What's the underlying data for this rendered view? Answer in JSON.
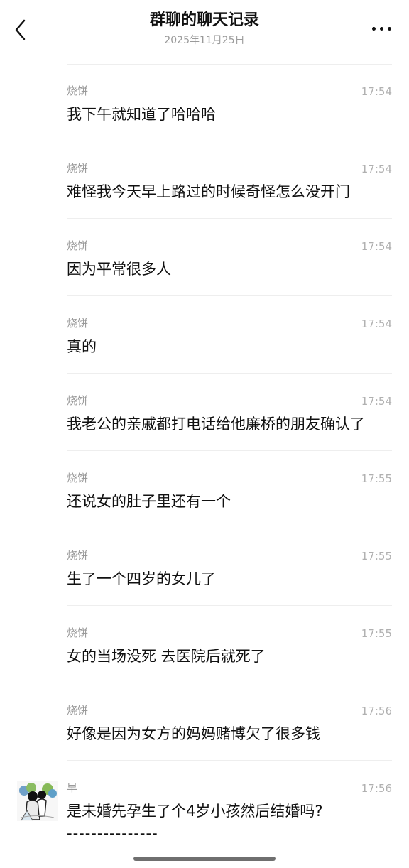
{
  "header": {
    "title": "群聊的聊天记录",
    "date": "2025年11月25日"
  },
  "icons": {
    "back": "chevron-left-icon",
    "more": "more-horizontal-icon"
  },
  "messages": [
    {
      "sender": "烧饼",
      "time": "17:54",
      "text": "我下午就知道了哈哈哈"
    },
    {
      "sender": "烧饼",
      "time": "17:54",
      "text": "难怪我今天早上路过的时候奇怪怎么没开门"
    },
    {
      "sender": "烧饼",
      "time": "17:54",
      "text": "因为平常很多人"
    },
    {
      "sender": "烧饼",
      "time": "17:54",
      "text": "真的"
    },
    {
      "sender": "烧饼",
      "time": "17:54",
      "text": "我老公的亲戚都打电话给他廉桥的朋友确认了"
    },
    {
      "sender": "烧饼",
      "time": "17:55",
      "text": "还说女的肚子里还有一个"
    },
    {
      "sender": "烧饼",
      "time": "17:55",
      "text": "生了一个四岁的女儿了"
    },
    {
      "sender": "烧饼",
      "time": "17:55",
      "text": "女的当场没死 去医院后就死了"
    },
    {
      "sender": "烧饼",
      "time": "17:56",
      "text": "好像是因为女方的妈妈赌博欠了很多钱"
    },
    {
      "sender": "早",
      "time": "17:56",
      "text": "是未婚先孕生了个4岁小孩然后结婚吗?",
      "separator": "---------------"
    }
  ],
  "colors": {
    "text": "#111111",
    "secondary": "#9a9a9a",
    "divider": "#eeeeee",
    "background": "#ffffff"
  }
}
